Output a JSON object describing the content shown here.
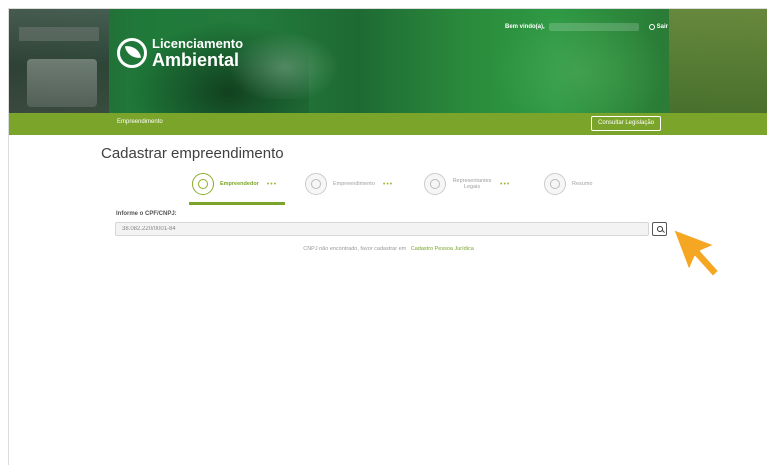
{
  "header": {
    "logo_line1": "Licenciamento",
    "logo_line2": "Ambiental",
    "greeting": "Bem vindo(a),",
    "logout_label": "Sair"
  },
  "nav": {
    "item": "Empreendimento",
    "consult_button": "Consultar Legislação"
  },
  "page": {
    "title": "Cadastrar empreendimento"
  },
  "steps": [
    {
      "label": "Empreendedor",
      "active": true
    },
    {
      "label": "Empreendimento",
      "active": false
    },
    {
      "label": "Representantes Legais",
      "active": false
    },
    {
      "label": "Resumo",
      "active": false
    }
  ],
  "form": {
    "cpf_label": "Informe o CPF/CNPJ:",
    "cpf_value": "38.082.220/0001-84"
  },
  "message": {
    "text": "CNPJ não encontrado, favor cadastrar em",
    "link": "Cadastro Pessoa Jurídica"
  },
  "colors": {
    "brand_green": "#7ba42a",
    "cursor_orange": "#f5a623"
  }
}
